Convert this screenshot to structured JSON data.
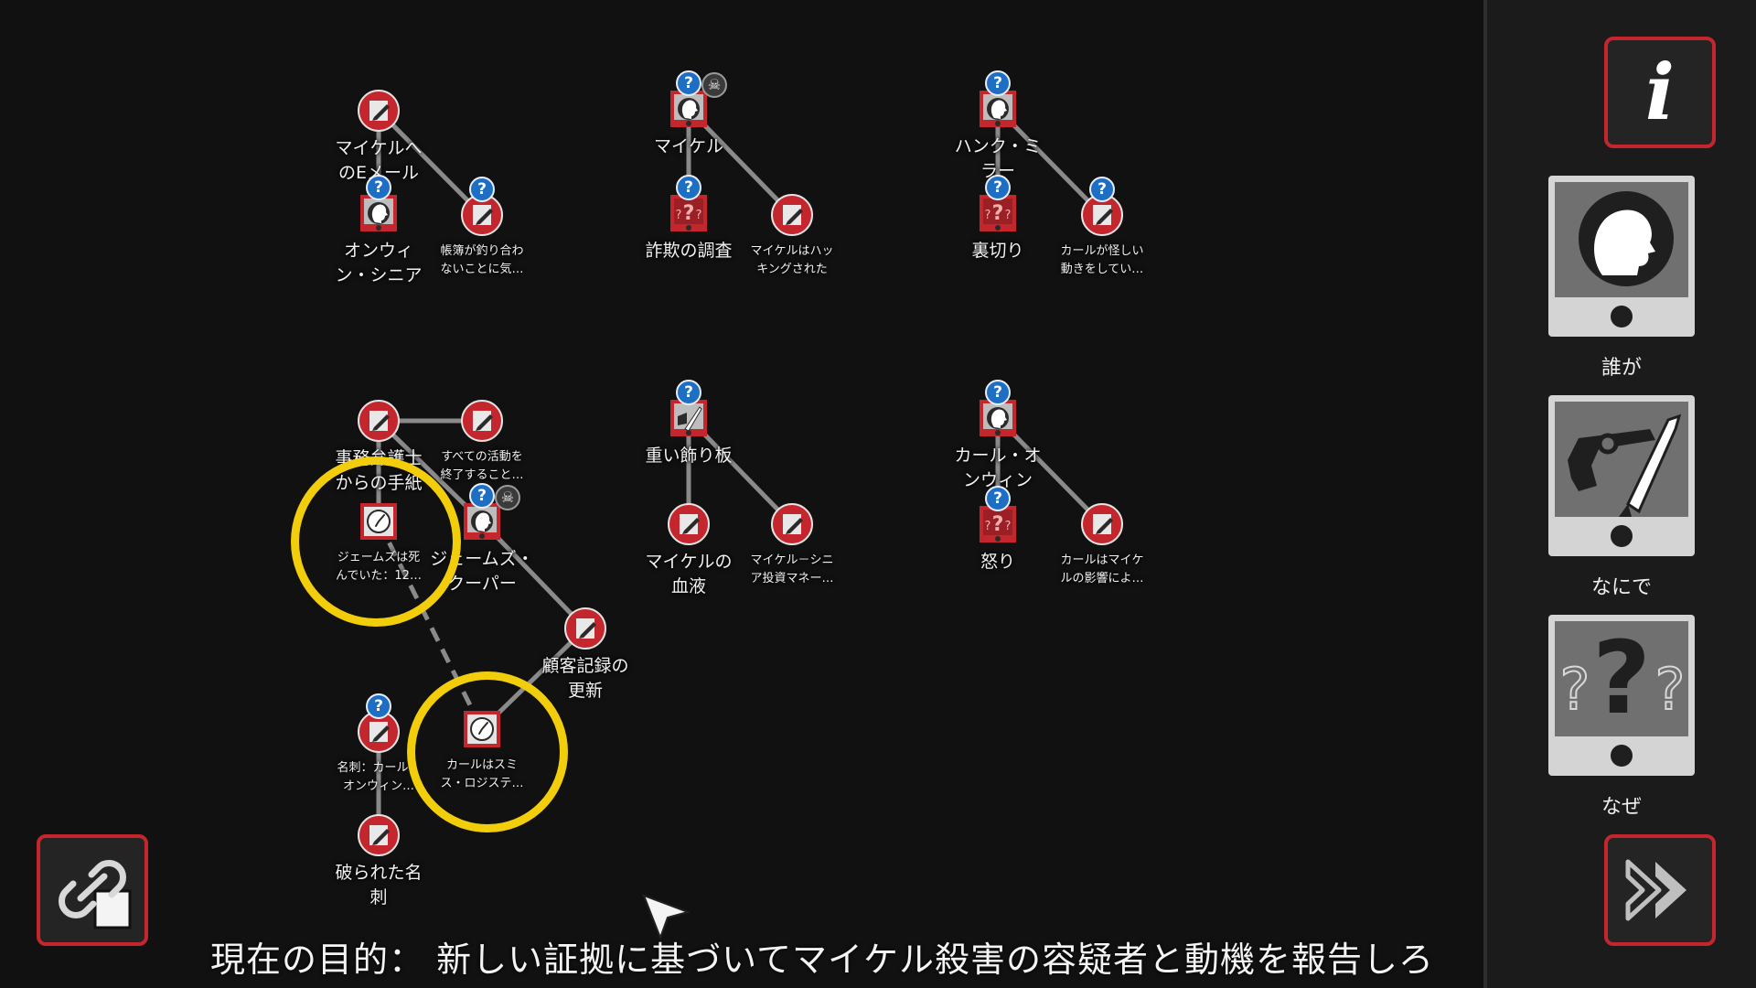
{
  "colors": {
    "accent": "#c4262e",
    "highlight": "#f2cd0c",
    "badge": "#1e6fc4",
    "background": "#111111"
  },
  "badge_glyph": "?",
  "skull_glyph": "☠",
  "nodes": {
    "email": {
      "label": "マイケルへ\nのEメール",
      "icon": "note-icon"
    },
    "onwin_sr": {
      "label": "オンウィ\nン・シニア",
      "icon": "person-icon"
    },
    "ledger": {
      "label": "帳簿が釣り合わ\nないことに気…",
      "icon": "note-icon"
    },
    "michael": {
      "label": "マイケル",
      "icon": "person-icon"
    },
    "fraud": {
      "label": "詐欺の調査",
      "icon": "motive-icon"
    },
    "hacked": {
      "label": "マイケルはハッ\nキングされた",
      "icon": "note-icon"
    },
    "hank": {
      "label": "ハンク・ミ\nラー",
      "icon": "person-icon"
    },
    "betrayal": {
      "label": "裏切り",
      "icon": "motive-icon"
    },
    "carl_susp": {
      "label": "カールが怪しい\n動きをしてい…",
      "icon": "note-icon"
    },
    "lawyer": {
      "label": "事務弁護士\nからの手紙",
      "icon": "note-icon"
    },
    "end_all": {
      "label": "すべての活動を\n終了すること…",
      "icon": "note-icon"
    },
    "james_dead": {
      "label": "ジェームズは死\nんでいた：12…",
      "icon": "clock-icon"
    },
    "james": {
      "label": "ジェームズ・\nクーパー",
      "icon": "person-icon"
    },
    "client": {
      "label": "顧客記録の\n更新",
      "icon": "note-icon"
    },
    "card_carl": {
      "label": "名刺：カール・\nオンウィン…",
      "icon": "note-icon"
    },
    "carl_smith": {
      "label": "カールはスミ\nス・ロジステ…",
      "icon": "clock-icon"
    },
    "torn": {
      "label": "破られた名\n刺",
      "icon": "note-icon"
    },
    "plank": {
      "label": "重い飾り板",
      "icon": "weapon-icon"
    },
    "blood": {
      "label": "マイケルの\n血液",
      "icon": "note-icon"
    },
    "sr_money": {
      "label": "マイケル－シニ\nア投資マネー…",
      "icon": "note-icon"
    },
    "carl": {
      "label": "カール・オ\nンウィン",
      "icon": "person-icon"
    },
    "anger": {
      "label": "怒り",
      "icon": "motive-icon"
    },
    "carl_infl": {
      "label": "カールはマイケ\nルの影響によ…",
      "icon": "note-icon"
    }
  },
  "sidebar": {
    "info_button": "i",
    "who_label": "誰が",
    "what_label": "なにで",
    "why_label": "なぜ"
  },
  "objective": "現在の目的： 新しい証拠に基づいてマイケル殺害の容疑者と動機を報告しろ"
}
